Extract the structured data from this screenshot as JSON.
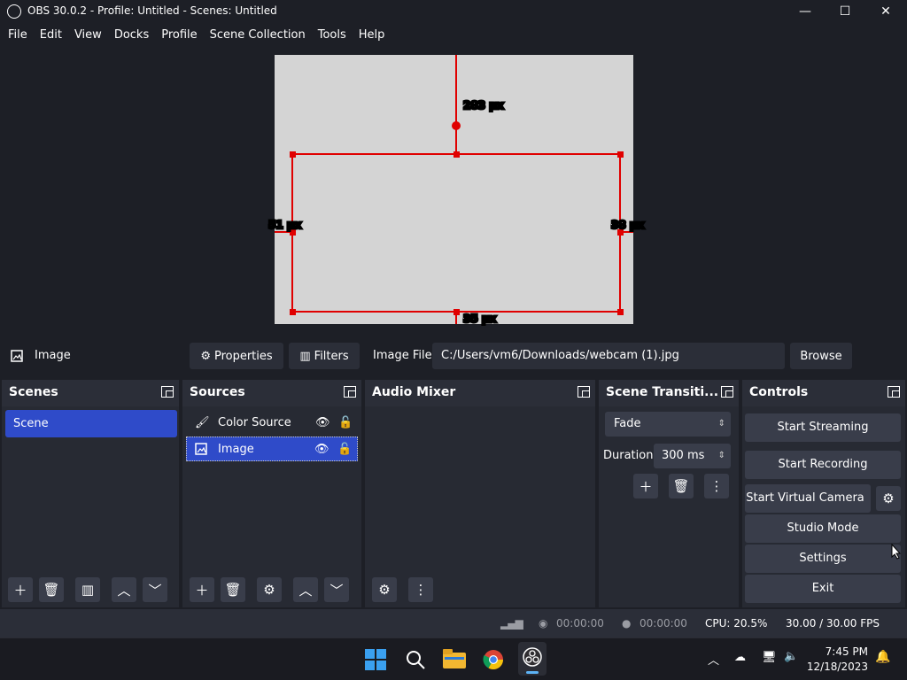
{
  "window": {
    "title": "OBS 30.0.2 - Profile: Untitled - Scenes: Untitled",
    "minimize": "—",
    "maximize": "☐",
    "close": "✕"
  },
  "menu": [
    "File",
    "Edit",
    "View",
    "Docks",
    "Profile",
    "Scene Collection",
    "Tools",
    "Help"
  ],
  "preview": {
    "top_label": "283 px",
    "left_label": "51 px",
    "right_label": "38 px",
    "bottom_label": "35 px",
    "overlay_color": "#e00000",
    "canvas_color": "#d4d4d4"
  },
  "source_toolbar": {
    "selected_source": "Image",
    "properties_label": "Properties",
    "filters_label": "Filters",
    "image_file_label": "Image File",
    "image_file_path": "C:/Users/vm6/Downloads/webcam (1).jpg",
    "browse_label": "Browse"
  },
  "scenes": {
    "title": "Scenes",
    "items": [
      "Scene"
    ]
  },
  "sources": {
    "title": "Sources",
    "items": [
      {
        "name": "Color Source",
        "icon": "paintbrush-icon",
        "visible": true,
        "locked": false
      },
      {
        "name": "Image",
        "icon": "image-icon",
        "visible": true,
        "locked": false,
        "selected": true
      }
    ]
  },
  "audio_mixer": {
    "title": "Audio Mixer"
  },
  "transitions": {
    "title": "Scene Transiti...",
    "selected": "Fade",
    "duration_label": "Duration",
    "duration_value": "300 ms"
  },
  "controls": {
    "title": "Controls",
    "start_streaming": "Start Streaming",
    "start_recording": "Start Recording",
    "start_virtual_camera": "Start Virtual Camera",
    "studio_mode": "Studio Mode",
    "settings": "Settings",
    "exit": "Exit"
  },
  "status": {
    "stream_time": "00:00:00",
    "record_time": "00:00:00",
    "cpu": "CPU: 20.5%",
    "fps": "30.00 / 30.00 FPS"
  },
  "taskbar": {
    "time": "7:45 PM",
    "date": "12/18/2023",
    "apps": [
      "windows-start-icon",
      "search-icon",
      "file-explorer-icon",
      "chrome-icon",
      "obs-icon"
    ]
  },
  "colors": {
    "accent": "#2f4bc9",
    "background": "#1d1f26",
    "panel": "#2b2e38",
    "button": "#393d4a"
  }
}
